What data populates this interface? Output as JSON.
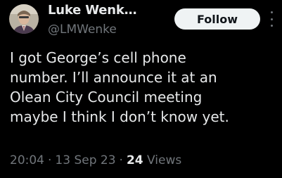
{
  "author": {
    "name": "Luke Wenk…",
    "handle": "@LMWenke"
  },
  "follow_label": "Follow",
  "text_lines": [
    "I got George’s cell phone",
    "number.  I’ll announce it at an",
    "Olean City Council meeting",
    "maybe I think I don’t know yet."
  ],
  "meta": {
    "time": "20:04",
    "separator": "·",
    "date": "13 Sep 23",
    "views_count": "24",
    "views_label": "Views"
  },
  "colors": {
    "background": "#000000",
    "primary_text": "#e7e9ea",
    "secondary_text": "#71767b",
    "follow_button_bg": "#eff3f4",
    "follow_button_text": "#0f1419"
  },
  "icons": {
    "more": "more-options-icon",
    "avatar": "avatar"
  }
}
